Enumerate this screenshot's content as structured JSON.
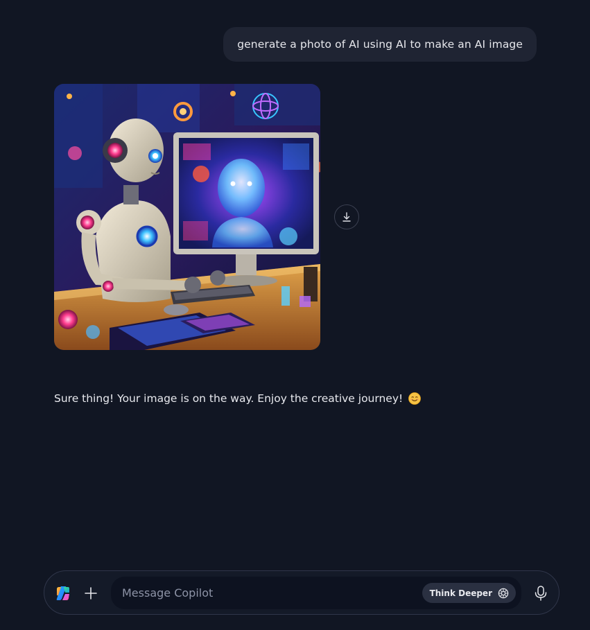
{
  "conversation": {
    "user_message": "generate a photo of AI using AI to make an AI image",
    "assistant_message": "Sure thing! Your image is on the way. Enjoy the creative journey!",
    "assistant_emoji": "smiling-face-icon",
    "image": {
      "alt": "Robot sitting at a desk using a computer showing a glowing AI face",
      "actions": {
        "download_icon": "download-icon"
      }
    }
  },
  "composer": {
    "logo_icon": "copilot-logo-icon",
    "attach_icon": "plus-icon",
    "placeholder": "Message Copilot",
    "value": "",
    "think_deeper_label": "Think Deeper",
    "think_deeper_icon": "think-deeper-icon",
    "mic_icon": "microphone-icon"
  },
  "colors": {
    "background": "#111623",
    "user_bubble": "#1f2433",
    "composer_border": "#30364a",
    "input_bg": "#0d1220",
    "think_button_bg": "#2a3041"
  }
}
